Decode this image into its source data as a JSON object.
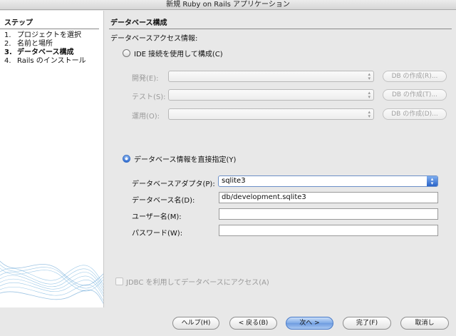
{
  "window": {
    "title": "新規 Ruby on Rails アプリケーション"
  },
  "steps": {
    "heading": "ステップ",
    "items": [
      {
        "num": "1.",
        "label": "プロジェクトを選択"
      },
      {
        "num": "2.",
        "label": "名前と場所"
      },
      {
        "num": "3.",
        "label": "データベース構成"
      },
      {
        "num": "4.",
        "label": "Rails のインストール"
      }
    ]
  },
  "main": {
    "heading": "データベース構成",
    "access_info_label": "データベースアクセス情報:",
    "ide_option": {
      "label": "IDE 接続を使用して構成(C)",
      "selected": false,
      "rows": [
        {
          "label": "開発(E):",
          "button": "DB の作成(R)..."
        },
        {
          "label": "テスト(S):",
          "button": "DB の作成(T)..."
        },
        {
          "label": "運用(O):",
          "button": "DB の作成(D)..."
        }
      ]
    },
    "direct_option": {
      "label": "データベース情報を直接指定(Y)",
      "selected": true,
      "adapter_label": "データベースアダプタ(P):",
      "adapter_value": "sqlite3",
      "dbname_label": "データベース名(D):",
      "dbname_value": "db/development.sqlite3",
      "user_label": "ユーザー名(M):",
      "user_value": "",
      "password_label": "パスワード(W):",
      "password_value": ""
    },
    "jdbc_checkbox": {
      "label": "JDBC を利用してデータベースにアクセス(A)",
      "checked": false
    }
  },
  "buttons": {
    "help": "ヘルプ(H)",
    "back": "< 戻る(B)",
    "next": "次へ >",
    "finish": "完了(F)",
    "cancel": "取消し"
  },
  "colors": {
    "accent": "#2f6bd1",
    "dialog_bg": "#e8e8e8",
    "pane_bg": "#ffffff"
  }
}
